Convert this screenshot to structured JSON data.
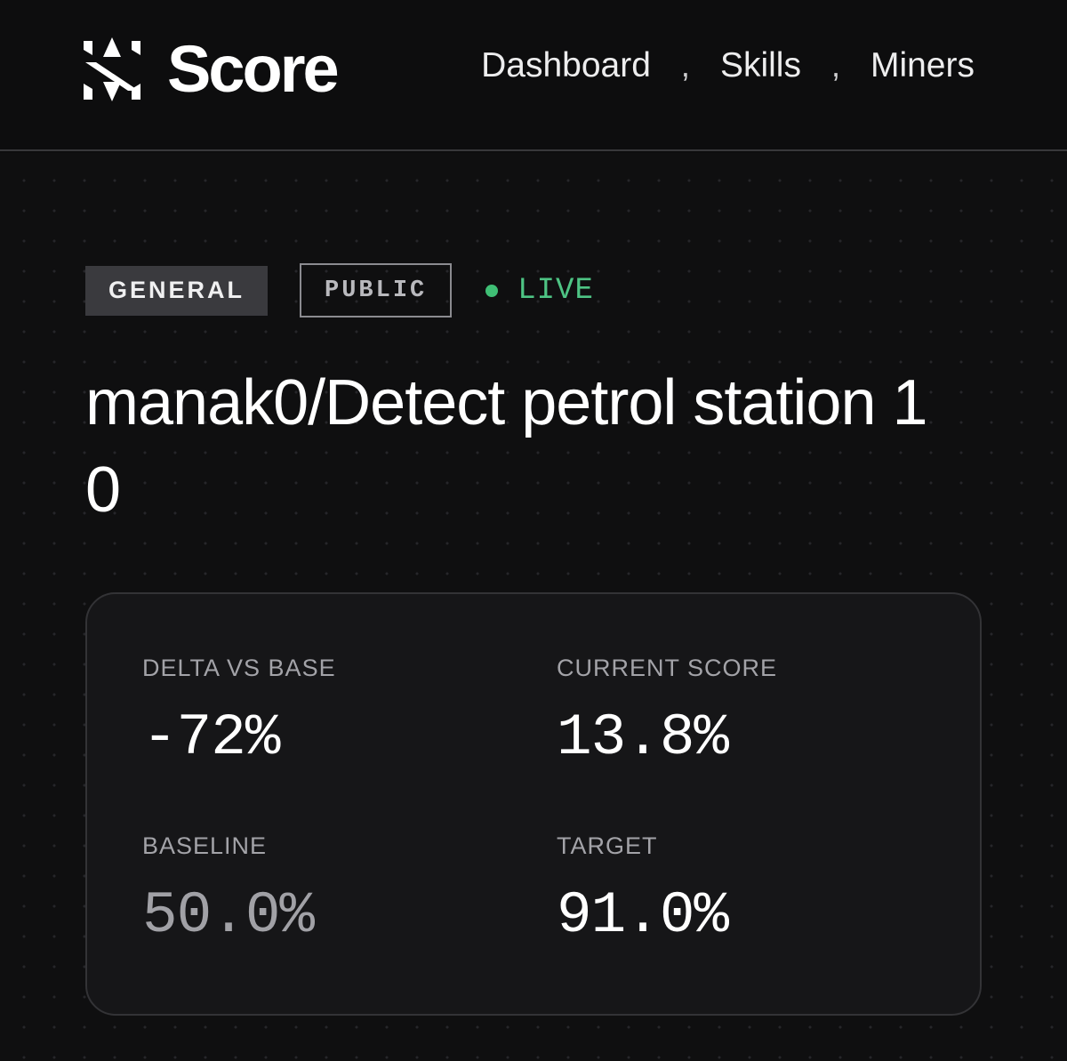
{
  "brand": {
    "name": "Score",
    "logo_icon": "score-logo-icon"
  },
  "nav": {
    "items": [
      {
        "label": "Dashboard"
      },
      {
        "label": "Skills"
      },
      {
        "label": "Miners"
      }
    ],
    "separator": ","
  },
  "badges": {
    "category": "GENERAL",
    "visibility": "PUBLIC",
    "status": "LIVE",
    "status_color": "#4ec484"
  },
  "page": {
    "title": "manak0/Detect petrol station 1 0"
  },
  "stats": {
    "delta": {
      "label": "DELTA VS BASE",
      "value": "-72%"
    },
    "current": {
      "label": "CURRENT SCORE",
      "value": "13.8%"
    },
    "baseline": {
      "label": "BASELINE",
      "value": "50.0%"
    },
    "target": {
      "label": "TARGET",
      "value": "91.0%"
    }
  }
}
